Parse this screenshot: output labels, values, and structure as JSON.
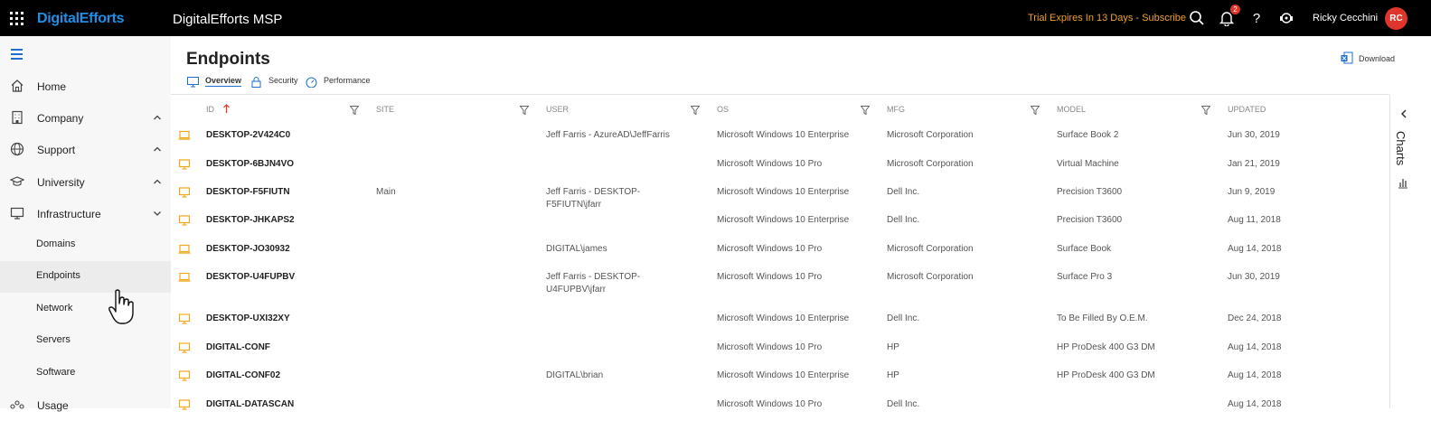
{
  "topbar": {
    "brand": "DigitalEfforts",
    "app_name": "DigitalEfforts MSP",
    "trial_text": "Trial Expires In 13 Days - Subscribe",
    "notification_count": "2",
    "user_name": "Ricky Cecchini",
    "avatar_initials": "RC",
    "icons": [
      "apps-grid-icon",
      "search-icon",
      "bell-icon",
      "help-icon",
      "support-agent-icon"
    ]
  },
  "sidebar": {
    "items": [
      {
        "label": "Home",
        "icon": "home-icon"
      },
      {
        "label": "Company",
        "icon": "building-icon",
        "expanded": false
      },
      {
        "label": "Support",
        "icon": "globe-icon",
        "expanded": false
      },
      {
        "label": "University",
        "icon": "graduation-cap-icon",
        "expanded": false
      },
      {
        "label": "Infrastructure",
        "icon": "monitor-icon",
        "expanded": true
      }
    ],
    "sub_items": [
      {
        "label": "Domains"
      },
      {
        "label": "Endpoints",
        "active": true
      },
      {
        "label": "Network"
      },
      {
        "label": "Servers"
      },
      {
        "label": "Software"
      },
      {
        "label": "Usage"
      }
    ]
  },
  "main": {
    "title": "Endpoints",
    "tabs": [
      {
        "label": "Overview",
        "icon": "monitor-icon",
        "active": true
      },
      {
        "label": "Security",
        "icon": "lock-icon"
      },
      {
        "label": "Performance",
        "icon": "gauge-icon"
      }
    ],
    "download_label": "Download"
  },
  "table": {
    "columns": [
      "ID",
      "SITE",
      "USER",
      "OS",
      "MFG",
      "MODEL",
      "UPDATED"
    ],
    "sort": {
      "column": "ID",
      "direction": "ascending"
    },
    "rows": [
      {
        "id": "DESKTOP-2V424C0",
        "site": "",
        "user": "Jeff Farris - AzureAD\\JeffFarris",
        "os": "Microsoft Windows 10 Enterprise",
        "mfg": "Microsoft Corporation",
        "model": "Surface Book 2",
        "updated": "Jun 30, 2019",
        "device": "laptop"
      },
      {
        "id": "DESKTOP-6BJN4VO",
        "site": "",
        "user": "",
        "os": "Microsoft Windows 10 Pro",
        "mfg": "Microsoft Corporation",
        "model": "Virtual Machine",
        "updated": "Jan 21, 2019",
        "device": "desktop"
      },
      {
        "id": "DESKTOP-F5FIUTN",
        "site": "Main",
        "user": "Jeff Farris - DESKTOP-F5FIUTN\\jfarr",
        "os": "Microsoft Windows 10 Enterprise",
        "mfg": "Dell Inc.",
        "model": "Precision T3600",
        "updated": "Jun 9, 2019",
        "device": "desktop"
      },
      {
        "id": "DESKTOP-JHKAPS2",
        "site": "",
        "user": "",
        "os": "Microsoft Windows 10 Enterprise",
        "mfg": "Dell Inc.",
        "model": "Precision T3600",
        "updated": "Aug 11, 2018",
        "device": "desktop"
      },
      {
        "id": "DESKTOP-JO30932",
        "site": "",
        "user": "DIGITAL\\james",
        "os": "Microsoft Windows 10 Pro",
        "mfg": "Microsoft Corporation",
        "model": "Surface Book",
        "updated": "Aug 14, 2018",
        "device": "laptop"
      },
      {
        "id": "DESKTOP-U4FUPBV",
        "site": "",
        "user": "Jeff Farris - DESKTOP-U4FUPBV\\jfarr",
        "user_line1": "Jeff Farris - DESKTOP-",
        "user_line2": "U4FUPBV\\jfarr",
        "os": "Microsoft Windows 10 Pro",
        "mfg": "Microsoft Corporation",
        "model": "Surface Pro 3",
        "updated": "Jun 30, 2019",
        "device": "laptop"
      },
      {
        "id": "DESKTOP-UXI32XY",
        "site": "",
        "user": "",
        "os": "Microsoft Windows 10 Enterprise",
        "mfg": "Dell Inc.",
        "model": "To Be Filled By O.E.M.",
        "updated": "Dec 24, 2018",
        "device": "desktop"
      },
      {
        "id": "DIGITAL-CONF",
        "site": "",
        "user": "",
        "os": "Microsoft Windows 10 Pro",
        "mfg": "HP",
        "model": "HP ProDesk 400 G3 DM",
        "updated": "Aug 14, 2018",
        "device": "desktop"
      },
      {
        "id": "DIGITAL-CONF02",
        "site": "",
        "user": "DIGITAL\\brian",
        "os": "Microsoft Windows 10 Enterprise",
        "mfg": "HP",
        "model": "HP ProDesk 400 G3 DM",
        "updated": "Aug 14, 2018",
        "device": "desktop"
      },
      {
        "id": "DIGITAL-DATASCAN",
        "site": "",
        "user": "",
        "os": "Microsoft Windows 10 Pro",
        "mfg": "Dell Inc.",
        "model": "",
        "updated": "Aug 14, 2018",
        "device": "desktop"
      }
    ]
  },
  "charts_panel": {
    "label": "Charts"
  },
  "colors": {
    "accent": "#1e6fd0",
    "brand": "#1e8fe6",
    "trial": "#f0a030",
    "device_icon": "#f0a818",
    "avatar": "#e0352b"
  }
}
